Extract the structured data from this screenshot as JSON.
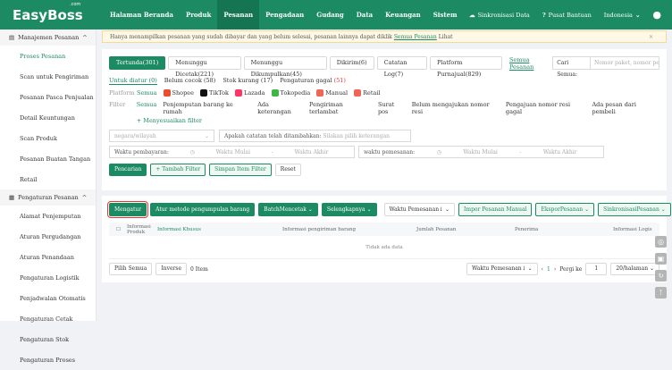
{
  "brand": {
    "name": "EasyBoss",
    "tld": ".com"
  },
  "topnav": [
    "Halaman Beranda",
    "Produk",
    "Pesanan",
    "Pengadaan",
    "Gudang",
    "Data",
    "Keuangan",
    "Sistem"
  ],
  "topright": {
    "sync": "Sinkronisasi Data",
    "help": "Pusat Bantuan",
    "lang": "Indonesia"
  },
  "sidebar": {
    "group1": "Manajemen Pesanan",
    "items1": [
      "Proses Pesanan",
      "Scan untuk Pengiriman",
      "Pesanan Pasca Penjualan",
      "Detail Keuntungan",
      "Scan Produk",
      "Pesanan Buatan Tangan",
      "Retail"
    ],
    "group2": "Pengaturan Pesanan",
    "items2": [
      "Alamat Penjemputan",
      "Aturan Pergudangan",
      "Aturan Penandaan",
      "Pengaturan Logistik",
      "Penjadwalan Otomatis",
      "Pengaturan Cetak",
      "Pengaturan Stok",
      "Pengaturan Proses"
    ]
  },
  "notice": {
    "text": "Hanya menampilkan pesanan yang sudah dibayar dan yang belum selesai, pesanan lainnya dapat diklik",
    "link": "Semua Pesanan",
    "tail": "Lihat"
  },
  "tabs": [
    "Tertunda(301)",
    "Menunggu Dicetak(221)",
    "Menunggu Dikumpulkan(45)",
    "Dikirim(6)",
    "Catatan Log(7)",
    "Platform Purnajual(829)"
  ],
  "tablink": "Semua Pesanan",
  "search": {
    "label": "Cari Semua:",
    "placeholder": "Nomor paket, nomor pesanan, n"
  },
  "subtabs": {
    "a": "Untuk diatur (0)",
    "b": "Belum cocok (58)",
    "c": "Stok kurang (17)",
    "d": "Pengaturan gagal",
    "d2": "(51)"
  },
  "platform": {
    "label": "Platform",
    "items": [
      "Semua",
      "Shopee",
      "TikTok",
      "Lazada",
      "Tokopedia",
      "Manual",
      "Retail"
    ]
  },
  "filter": {
    "label": "Filter",
    "items": [
      "Semua",
      "Penjemputan barang ke rumah",
      "Ada keterangan",
      "Pengiriman terlambat",
      "Surat pos",
      "Belum mengajukan nomor resi",
      "Pengajuan nomor resi gagal",
      "Ada pesan dari pembeli"
    ],
    "custom": "+ Menyesuaikan filter"
  },
  "sel": {
    "country": "negara/wilayah",
    "note_label": "Apakah catatan telah ditambahkan:",
    "note_ph": "Silakan pilih keterangan"
  },
  "dates": {
    "pay": "Waktu pembayaran:",
    "start": "Waktu Mulai",
    "end": "Waktu Akhir",
    "order": "waktu pemesanan:"
  },
  "btns": {
    "search": "Pencarian",
    "addf": "+ Tambah Filter",
    "save": "Simpan Item Filter",
    "reset": "Reset"
  },
  "acts": {
    "a": "Mengatur",
    "b": "Atur metode pengumpulan barang",
    "c": "BatchMencetak",
    "d": "Selengkapnya",
    "sort": "Waktu Pemesanan↓",
    "imp": "Impor Pesanan Manual",
    "exp": "EksporPesanan",
    "sync": "SinkronisasiPesanan"
  },
  "cols": {
    "a": "Informasi Produk",
    "b": "Informasi Khusus",
    "c": "Informasi pengiriman barang",
    "d": "Jumlah Pesanan",
    "e": "Penerima",
    "f": "Informasi Logis"
  },
  "empty": "Tidak ada data",
  "foot": {
    "all": "Pilih Semua",
    "inv": "Inverse",
    "n": "0 Item",
    "sort": "Waktu Pemesanan↓",
    "page": "1",
    "goto": "Pergi ke",
    "gv": "1",
    "size": "20/halaman"
  }
}
